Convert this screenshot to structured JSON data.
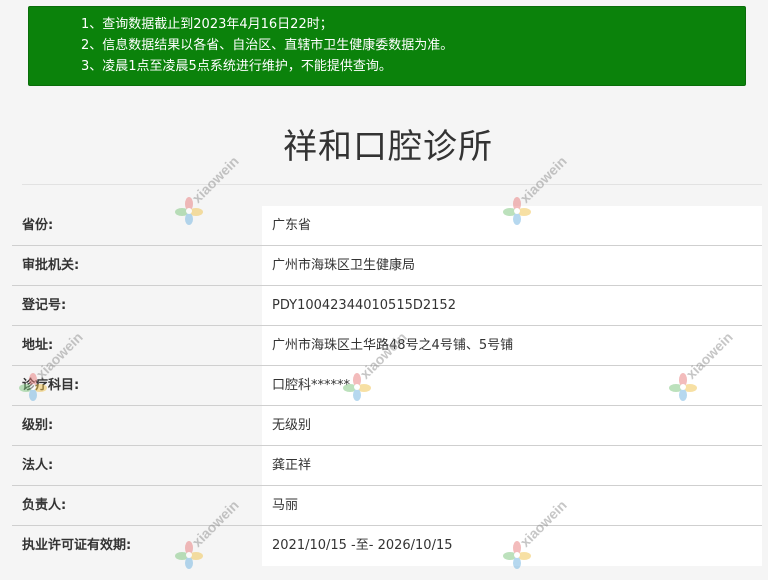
{
  "notice": {
    "lines": [
      "1、查询数据截止到2023年4月16日22时；",
      "2、信息数据结果以各省、自治区、直辖市卫生健康委数据为准。",
      "3、凌晨1点至凌晨5点系统进行维护，不能提供查询。"
    ]
  },
  "clinic": {
    "name": "祥和口腔诊所"
  },
  "rows": [
    {
      "label": "省份:",
      "value": "广东省"
    },
    {
      "label": "审批机关:",
      "value": "广州市海珠区卫生健康局"
    },
    {
      "label": "登记号:",
      "value": "PDY10042344010515D2152"
    },
    {
      "label": "地址:",
      "value": "广州市海珠区土华路48号之4号铺、5号铺"
    },
    {
      "label": "诊疗科目:",
      "value": "口腔科******"
    },
    {
      "label": "级别:",
      "value": "无级别"
    },
    {
      "label": "法人:",
      "value": "龚正祥"
    },
    {
      "label": "负责人:",
      "value": "马丽"
    },
    {
      "label": "执业许可证有效期:",
      "value": "2021/10/15 -至- 2026/10/15"
    }
  ],
  "watermark": {
    "text": "xiaowein",
    "icon": "flower-logo-icon"
  },
  "colors": {
    "notice_bg": "#0b820b",
    "label_bg": "#f5f5f5",
    "value_bg": "#ffffff"
  }
}
